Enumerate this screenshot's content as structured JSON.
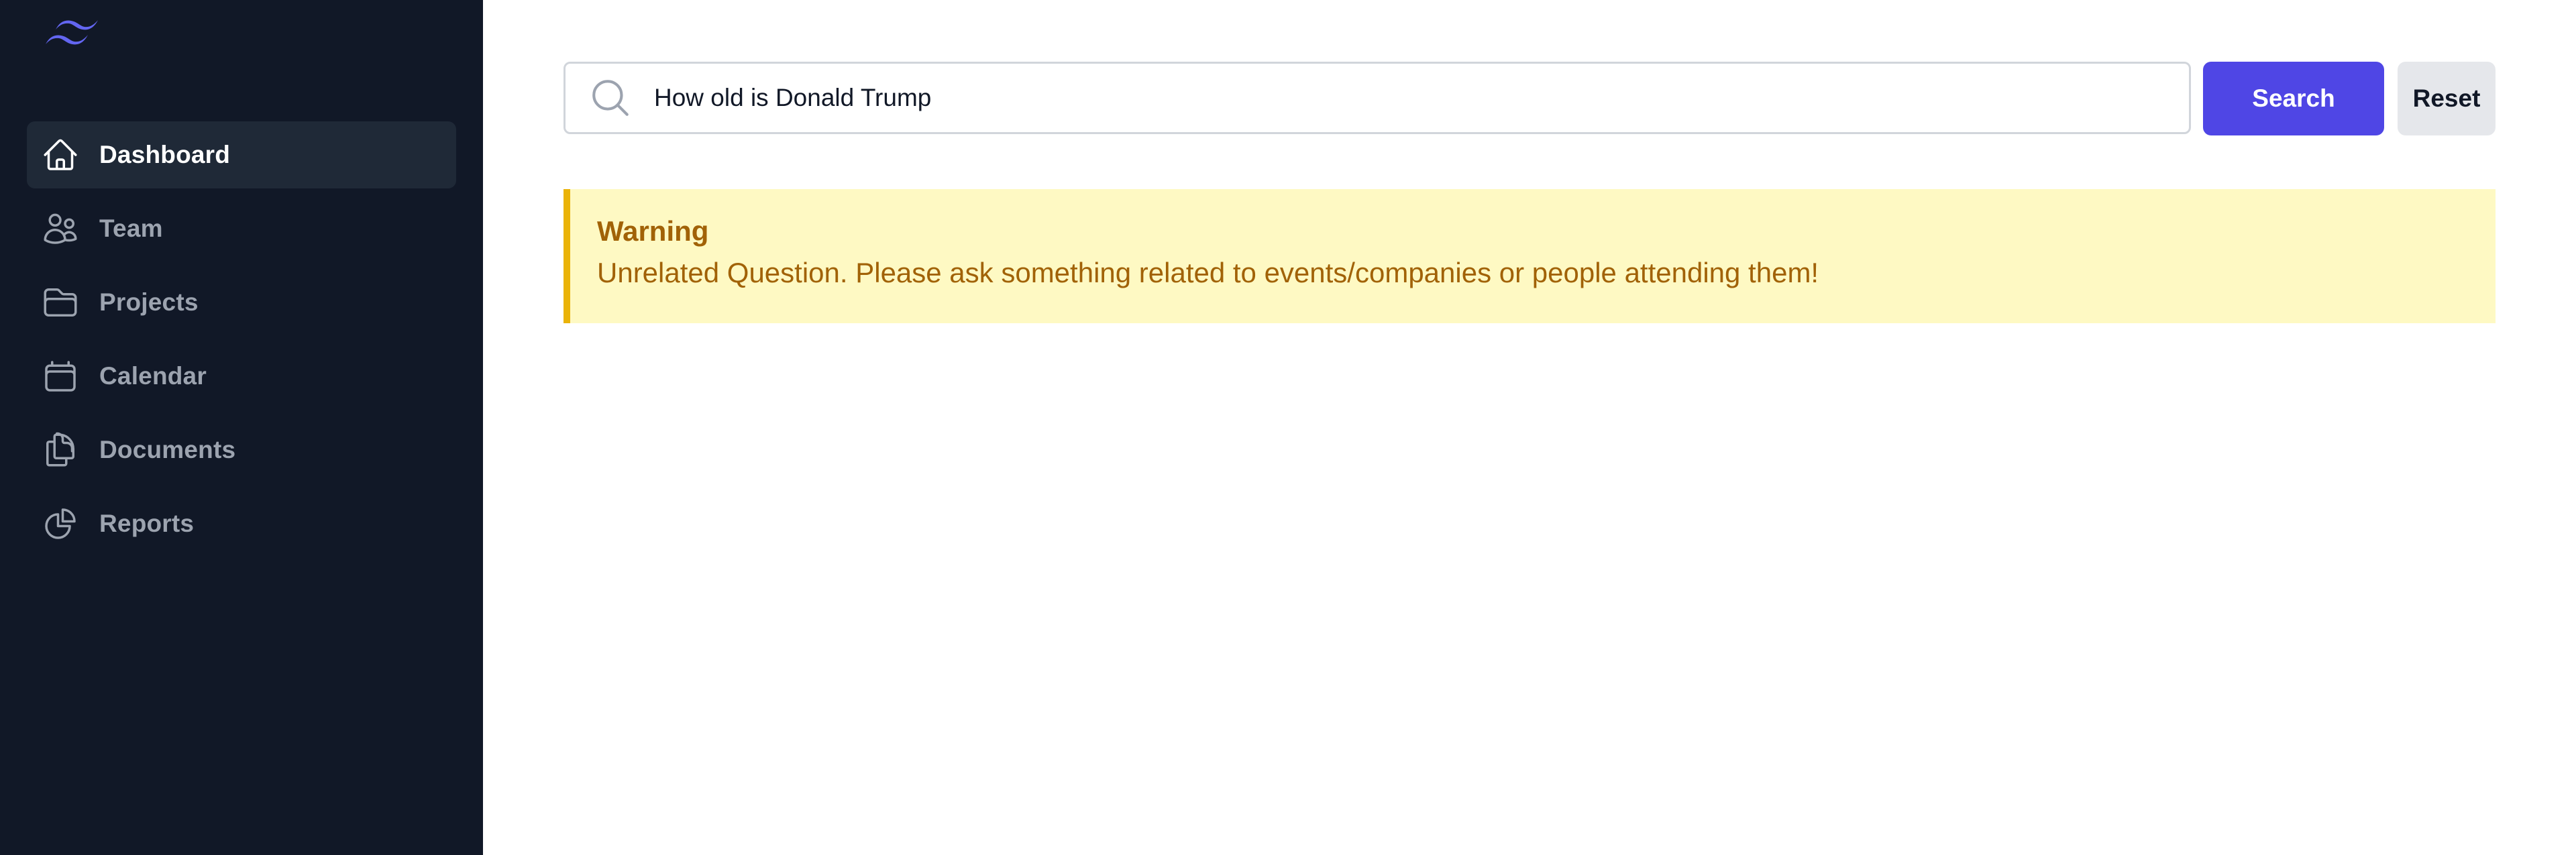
{
  "sidebar": {
    "logo_icon": "wave-logo-icon",
    "brand_color": "#6366f1",
    "items": [
      {
        "label": "Dashboard",
        "icon": "home-icon",
        "active": true
      },
      {
        "label": "Team",
        "icon": "users-icon",
        "active": false
      },
      {
        "label": "Projects",
        "icon": "folder-icon",
        "active": false
      },
      {
        "label": "Calendar",
        "icon": "calendar-icon",
        "active": false
      },
      {
        "label": "Documents",
        "icon": "documents-icon",
        "active": false
      },
      {
        "label": "Reports",
        "icon": "pie-chart-icon",
        "active": false
      }
    ]
  },
  "search": {
    "icon": "search-icon",
    "value": "How old is Donald Trump",
    "placeholder": "",
    "search_label": "Search",
    "reset_label": "Reset",
    "accent": "#4f46e5"
  },
  "alert": {
    "title": "Warning",
    "message": "Unrelated Question. Please ask something related to events/companies or people attending them!",
    "background": "#fef9c3",
    "border": "#eab308",
    "text_color": "#a16207"
  }
}
